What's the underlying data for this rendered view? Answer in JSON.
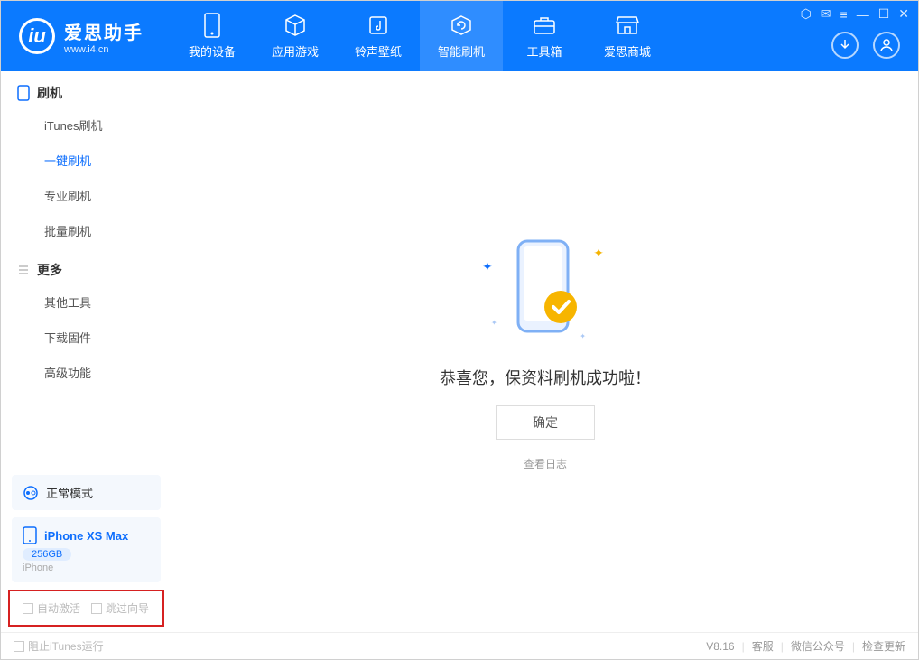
{
  "app": {
    "name": "爱思助手",
    "url": "www.i4.cn"
  },
  "nav": {
    "items": [
      {
        "label": "我的设备"
      },
      {
        "label": "应用游戏"
      },
      {
        "label": "铃声壁纸"
      },
      {
        "label": "智能刷机"
      },
      {
        "label": "工具箱"
      },
      {
        "label": "爱思商城"
      }
    ]
  },
  "sidebar": {
    "section1": {
      "title": "刷机",
      "items": [
        "iTunes刷机",
        "一键刷机",
        "专业刷机",
        "批量刷机"
      ]
    },
    "section2": {
      "title": "更多",
      "items": [
        "其他工具",
        "下载固件",
        "高级功能"
      ]
    },
    "mode": "正常模式",
    "device": {
      "name": "iPhone XS Max",
      "storage": "256GB",
      "type": "iPhone"
    },
    "checks": {
      "auto_activate": "自动激活",
      "skip_guide": "跳过向导"
    }
  },
  "main": {
    "message": "恭喜您，保资料刷机成功啦！",
    "ok": "确定",
    "view_log": "查看日志"
  },
  "footer": {
    "block_itunes": "阻止iTunes运行",
    "version": "V8.16",
    "support": "客服",
    "wechat": "微信公众号",
    "update": "检查更新"
  }
}
